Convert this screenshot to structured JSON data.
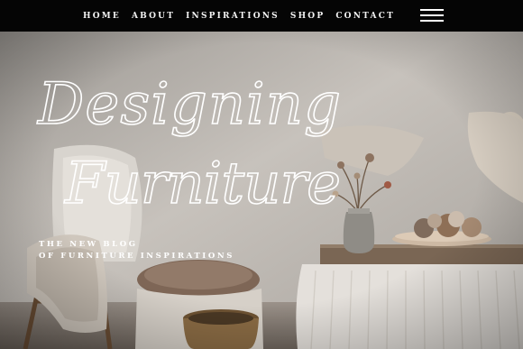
{
  "nav": {
    "items": [
      {
        "label": "HOME"
      },
      {
        "label": "ABOUT"
      },
      {
        "label": "INSPIRATIONS"
      },
      {
        "label": "SHOP"
      },
      {
        "label": "CONTACT"
      }
    ],
    "menu_icon": "hamburger-menu-icon"
  },
  "hero": {
    "title_line1": "Designing",
    "title_line2": "Furniture",
    "subtitle_line1": "THE NEW BLOG",
    "subtitle_line2": "OF FURNITURE INSPIRATIONS"
  },
  "colors": {
    "nav_background": "#050505",
    "nav_text": "#f2f2f2",
    "title_stroke": "#ffffff",
    "wall": "#b9b4ae"
  }
}
